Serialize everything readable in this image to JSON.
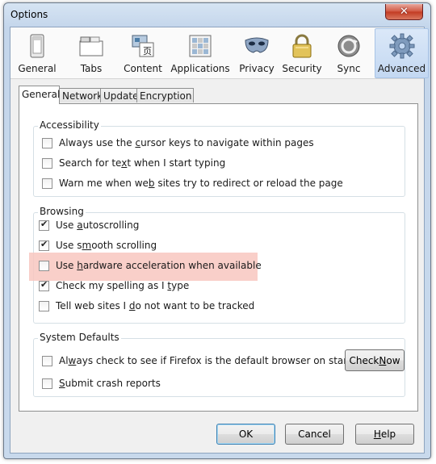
{
  "window": {
    "title": "Options",
    "close_glyph": "✕"
  },
  "toolbar": {
    "panes": [
      {
        "label": "General",
        "icon": "general-icon"
      },
      {
        "label": "Tabs",
        "icon": "tabs-icon"
      },
      {
        "label": "Content",
        "icon": "content-icon"
      },
      {
        "label": "Applications",
        "icon": "applications-icon"
      },
      {
        "label": "Privacy",
        "icon": "privacy-mask-icon"
      },
      {
        "label": "Security",
        "icon": "padlock-icon"
      },
      {
        "label": "Sync",
        "icon": "sync-icon"
      },
      {
        "label": "Advanced",
        "icon": "gear-icon",
        "selected": true
      }
    ]
  },
  "subtabs": [
    {
      "label": "General",
      "active": true
    },
    {
      "label": "Network",
      "active": false
    },
    {
      "label": "Update",
      "active": false
    },
    {
      "label": "Encryption",
      "active": false
    }
  ],
  "accessibility": {
    "title": "Accessibility",
    "items": [
      {
        "pre": "Always use the ",
        "key": "c",
        "post": "ursor keys to navigate within pages",
        "checked": false
      },
      {
        "pre": "Search for te",
        "key": "x",
        "post": "t when I start typing",
        "checked": false
      },
      {
        "pre": "Warn me when we",
        "key": "b",
        "post": " sites try to redirect or reload the page",
        "checked": false
      }
    ]
  },
  "browsing": {
    "title": "Browsing",
    "items": [
      {
        "pre": "Use ",
        "key": "a",
        "post": "utoscrolling",
        "checked": true
      },
      {
        "pre": "Use s",
        "key": "m",
        "post": "ooth scrolling",
        "checked": true
      },
      {
        "pre": "Use ",
        "key": "h",
        "post": "ardware acceleration when available",
        "checked": false
      },
      {
        "pre": "Check my spelling as I ",
        "key": "t",
        "post": "ype",
        "checked": true
      },
      {
        "pre": "Tell web sites I ",
        "key": "d",
        "post": "o not want to be tracked",
        "checked": false
      }
    ]
  },
  "system_defaults": {
    "title": "System Defaults",
    "items": [
      {
        "pre": "Al",
        "key": "w",
        "post": "ays check to see if Firefox is the default browser on startup",
        "checked": false
      },
      {
        "pre": "",
        "key": "S",
        "post": "ubmit crash reports",
        "checked": false
      }
    ],
    "check_now": {
      "pre": "Check ",
      "key": "N",
      "post": "ow"
    }
  },
  "buttons": {
    "ok": "OK",
    "cancel": "Cancel",
    "help_key": "H",
    "help_rest": "elp"
  },
  "colors": {
    "highlight": "#f8c7c0",
    "selected_pane": "#c3d8f2",
    "window_frame": "#c4d6eb"
  }
}
